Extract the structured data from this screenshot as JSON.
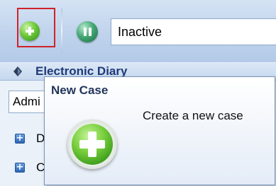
{
  "toolbar": {
    "add_button": {
      "icon": "add-icon"
    },
    "pause_button": {
      "icon": "pause-icon"
    },
    "status_value": "Inactive"
  },
  "diary": {
    "icon": "diary-icon",
    "title": "Electronic Diary"
  },
  "combo": {
    "value": "Admi"
  },
  "tree": {
    "items": [
      {
        "label": "D",
        "expander": "+"
      },
      {
        "label": "C",
        "expander": "+"
      }
    ]
  },
  "tooltip": {
    "title": "New Case",
    "description": "Create a new case",
    "icon": "add-icon"
  },
  "colors": {
    "highlight": "#d0232a",
    "accent_green": "#3a9a1b",
    "diary_title": "#1f3a77"
  }
}
